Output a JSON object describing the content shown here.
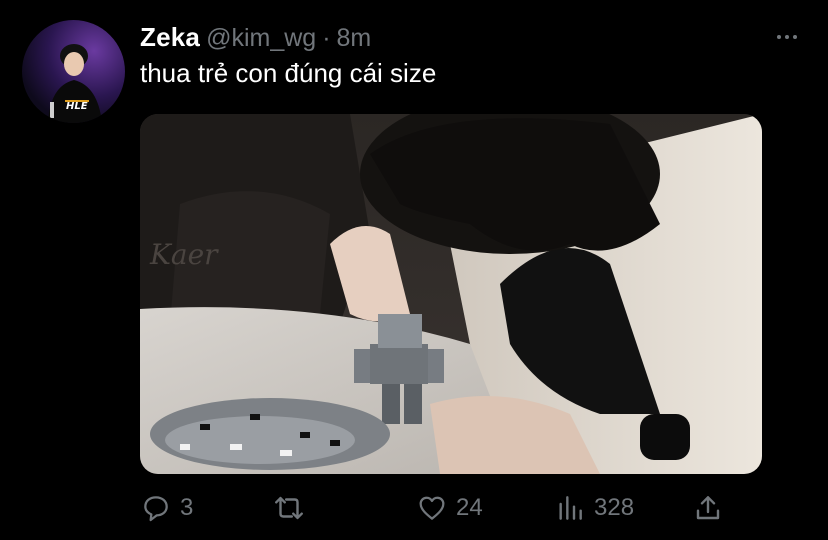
{
  "tweet": {
    "author": {
      "display_name": "Zeka",
      "handle": "@kim_wg",
      "avatar_badge_text": "HLE"
    },
    "separator": "·",
    "time": "8m",
    "text": "thua trẻ con đúng cái size",
    "media_icon": "photo",
    "more_icon": "more-horizontal-icon"
  },
  "actions": {
    "reply": {
      "icon": "reply-icon",
      "count": "3"
    },
    "retweet": {
      "icon": "retweet-icon",
      "count": ""
    },
    "like": {
      "icon": "heart-icon",
      "count": "24"
    },
    "views": {
      "icon": "views-icon",
      "count": "328"
    },
    "share": {
      "icon": "share-icon",
      "count": ""
    }
  },
  "colors": {
    "background": "#000000",
    "primary_text": "#ffffff",
    "secondary_text": "#71767b"
  }
}
